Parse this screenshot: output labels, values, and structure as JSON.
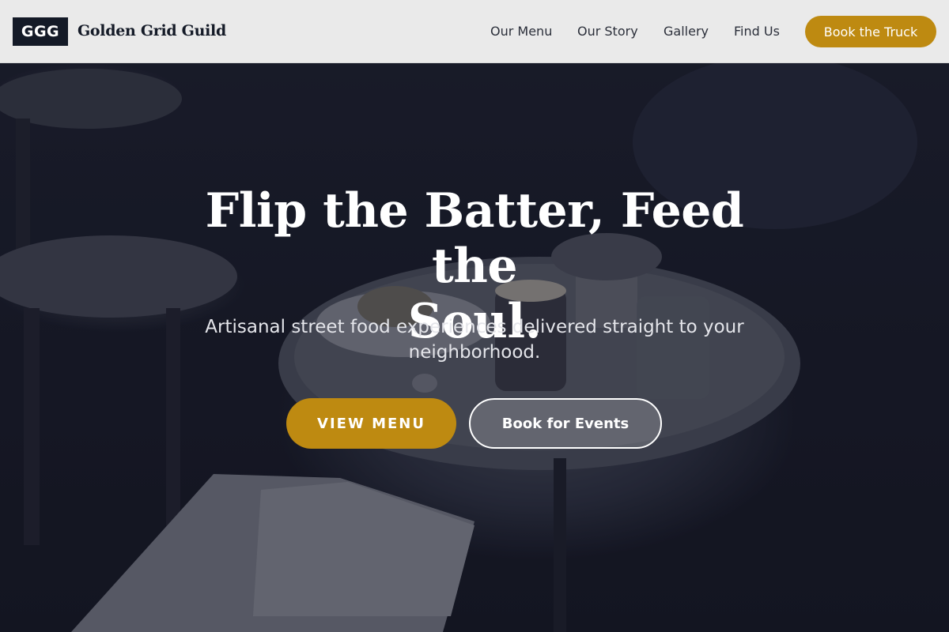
{
  "brand": {
    "logo_text": "GGG",
    "name": "Golden Grid Guild"
  },
  "nav": {
    "items": [
      {
        "label": "Our Menu"
      },
      {
        "label": "Our Story"
      },
      {
        "label": "Gallery"
      },
      {
        "label": "Find Us"
      }
    ],
    "cta_label": "Book the Truck"
  },
  "hero": {
    "headline_line1": "Flip the Batter, Feed the",
    "headline_line2": "Soul.",
    "subtitle_line1": "Artisanal street food experiences delivered straight to your",
    "subtitle_line2": "neighborhood.",
    "primary_button": "VIEW MENU",
    "secondary_button": "Book for Events",
    "background_description_icon": "cafe-table-photo"
  },
  "colors": {
    "accent": "#be8a11",
    "dark": "#141a27",
    "header_bg": "#eaeaea"
  }
}
